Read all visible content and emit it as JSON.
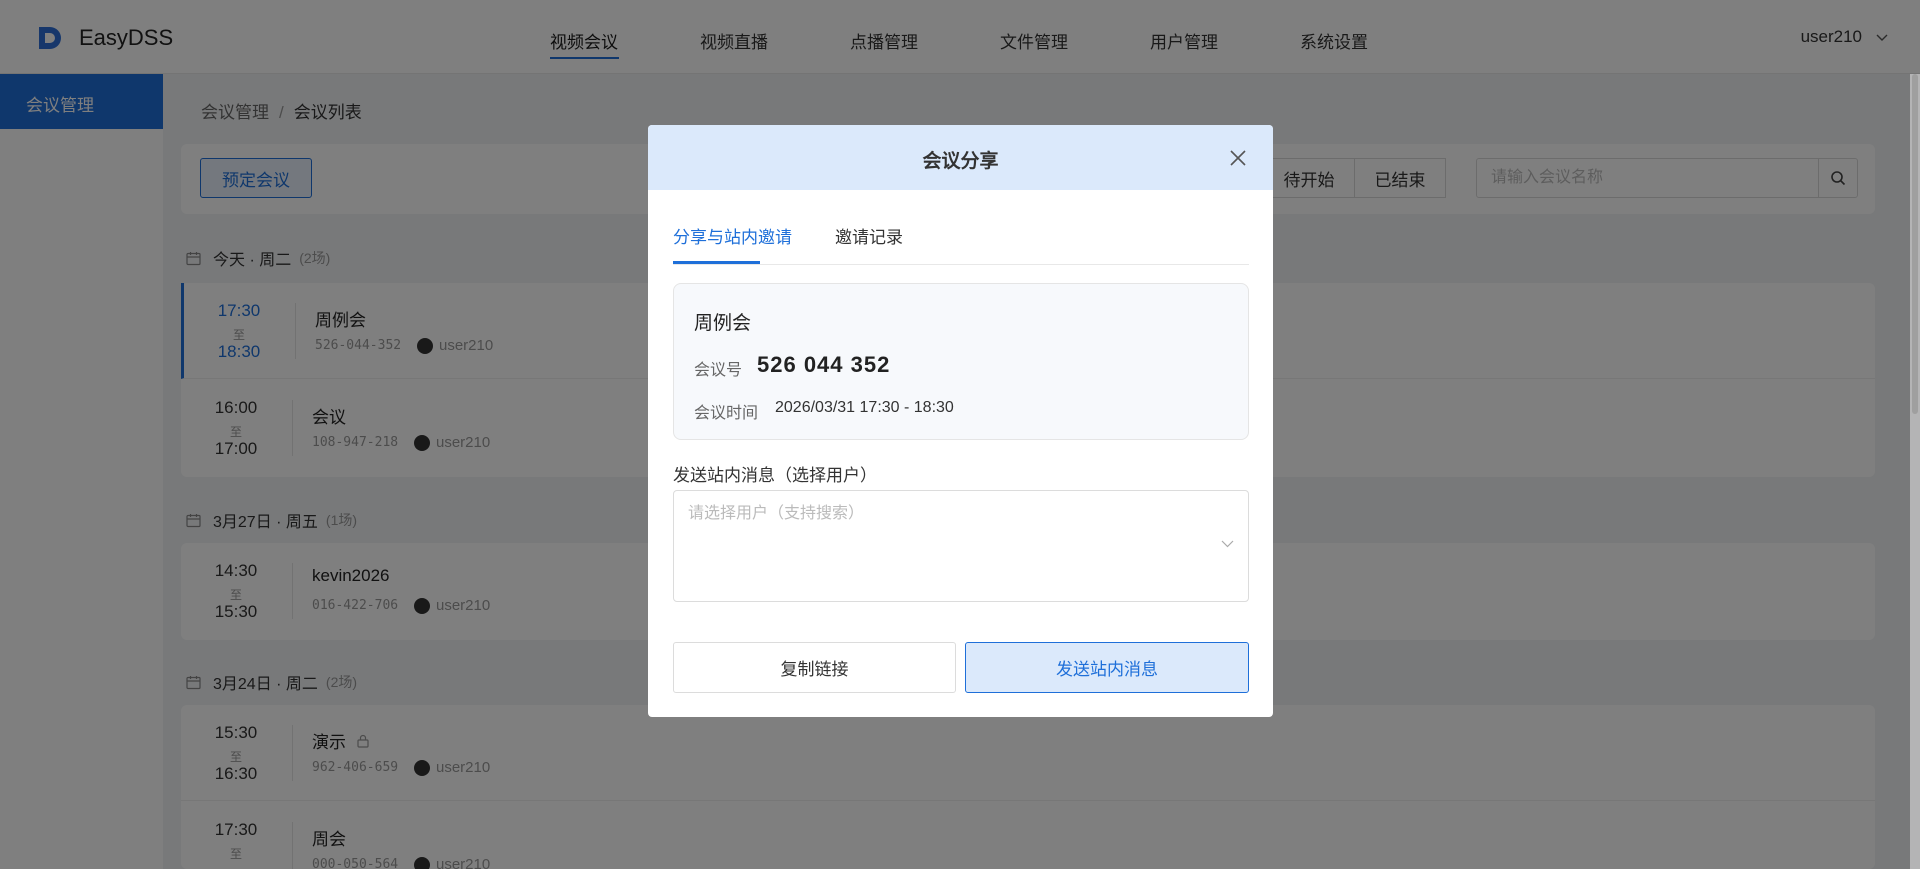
{
  "app": {
    "name": "EasyDSS"
  },
  "nav": {
    "items": [
      {
        "label": "视频会议"
      },
      {
        "label": "视频直播"
      },
      {
        "label": "点播管理"
      },
      {
        "label": "文件管理"
      },
      {
        "label": "用户管理"
      },
      {
        "label": "系统设置"
      }
    ],
    "user": "user210"
  },
  "sidebar": {
    "items": [
      {
        "label": "会议管理"
      }
    ]
  },
  "breadcrumb": {
    "parent": "会议管理",
    "separator": "/",
    "current": "会议列表"
  },
  "toolbar": {
    "book_label": "预定会议",
    "filters": [
      {
        "label": ""
      },
      {
        "label": "待开始"
      },
      {
        "label": "已结束"
      }
    ],
    "search_placeholder": "请输入会议名称"
  },
  "days": [
    {
      "label": "今天 · 周二",
      "count": "(2场)",
      "meetings": [
        {
          "start": "17:30",
          "to": "至",
          "end": "18:30",
          "title": "周例会",
          "id": "526-044-352",
          "user": "user210",
          "locked": false
        },
        {
          "start": "16:00",
          "to": "至",
          "end": "17:00",
          "title": "会议",
          "id": "108-947-218",
          "user": "user210",
          "locked": false
        }
      ]
    },
    {
      "label": "3月27日 · 周五",
      "count": "(1场)",
      "meetings": [
        {
          "start": "14:30",
          "to": "至",
          "end": "15:30",
          "title": "kevin2026",
          "id": "016-422-706",
          "user": "user210",
          "locked": false
        }
      ]
    },
    {
      "label": "3月24日 · 周二",
      "count": "(2场)",
      "meetings": [
        {
          "start": "15:30",
          "to": "至",
          "end": "16:30",
          "title": "演示",
          "id": "962-406-659",
          "user": "user210",
          "locked": true
        },
        {
          "start": "17:30",
          "to": "至",
          "end": "",
          "title": "周会",
          "id": "000-050-564",
          "user": "user210",
          "locked": false
        }
      ]
    }
  ],
  "modal": {
    "title": "会议分享",
    "tabs": [
      {
        "label": "分享与站内邀请"
      },
      {
        "label": "邀请记录"
      }
    ],
    "info": {
      "title": "周例会",
      "id_label": "会议号",
      "id_value": "526 044 352",
      "time_label": "会议时间",
      "time_value": "2026/03/31 17:30 - 18:30"
    },
    "send_label": "发送站内消息（选择用户）",
    "select_placeholder": "请选择用户（支持搜索）",
    "copy_label": "复制链接",
    "send_button_label": "发送站内消息"
  },
  "colors": {
    "accent": "#1e6fd9",
    "modal_header": "#dbe9fb"
  }
}
